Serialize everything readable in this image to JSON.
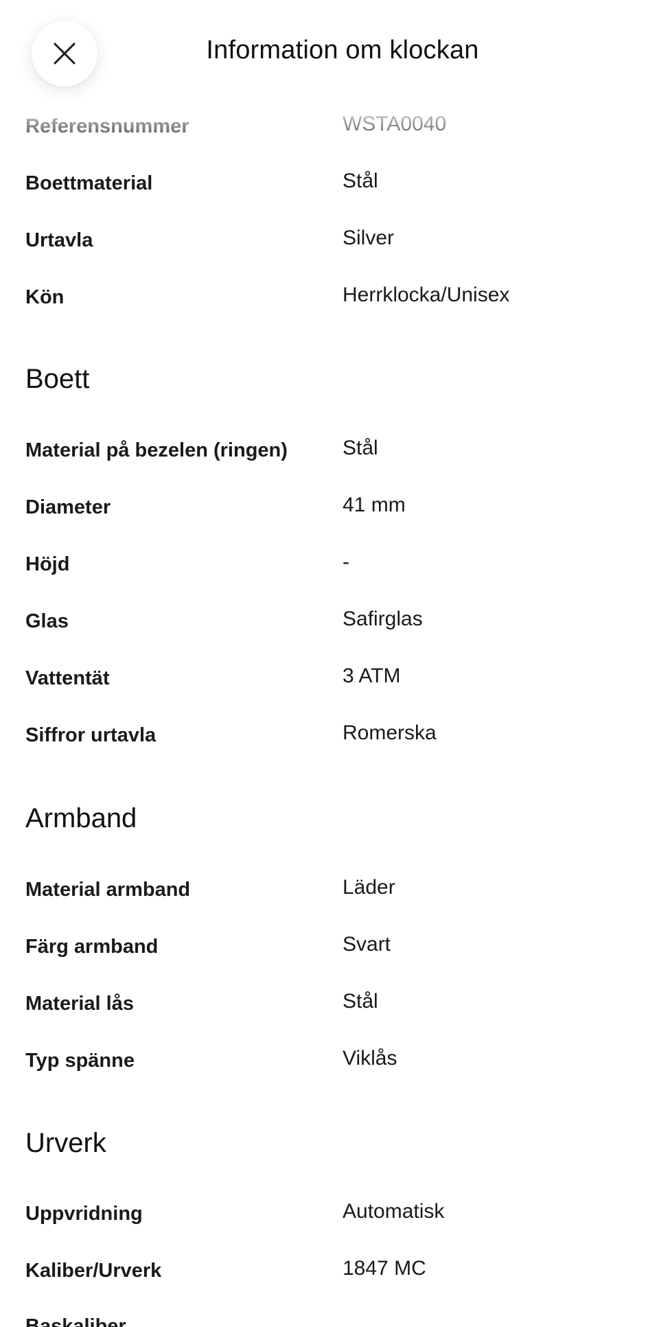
{
  "header": {
    "title": "Information om klockan",
    "close_icon": "close-icon"
  },
  "general": {
    "rows": [
      {
        "label": "Referensnummer",
        "value": "WSTA0040"
      },
      {
        "label": "Boettmaterial",
        "value": "Stål"
      },
      {
        "label": "Urtavla",
        "value": "Silver"
      },
      {
        "label": "Kön",
        "value": "Herrklocka/Unisex"
      }
    ]
  },
  "boett": {
    "title": "Boett",
    "rows": [
      {
        "label": "Material på bezelen (ringen)",
        "value": "Stål"
      },
      {
        "label": "Diameter",
        "value": "41 mm"
      },
      {
        "label": "Höjd",
        "value": "-"
      },
      {
        "label": "Glas",
        "value": "Safirglas"
      },
      {
        "label": "Vattentät",
        "value": "3 ATM"
      },
      {
        "label": "Siffror urtavla",
        "value": "Romerska"
      }
    ]
  },
  "armband": {
    "title": "Armband",
    "rows": [
      {
        "label": "Material armband",
        "value": "Läder"
      },
      {
        "label": "Färg armband",
        "value": "Svart"
      },
      {
        "label": "Material lås",
        "value": "Stål"
      },
      {
        "label": "Typ spänne",
        "value": "Viklås"
      }
    ]
  },
  "urverk": {
    "title": "Urverk",
    "rows": [
      {
        "label": "Uppvridning",
        "value": "Automatisk"
      },
      {
        "label": "Kaliber/Urverk",
        "value": "1847 MC"
      },
      {
        "label": "Baskaliber",
        "value": ""
      }
    ]
  }
}
